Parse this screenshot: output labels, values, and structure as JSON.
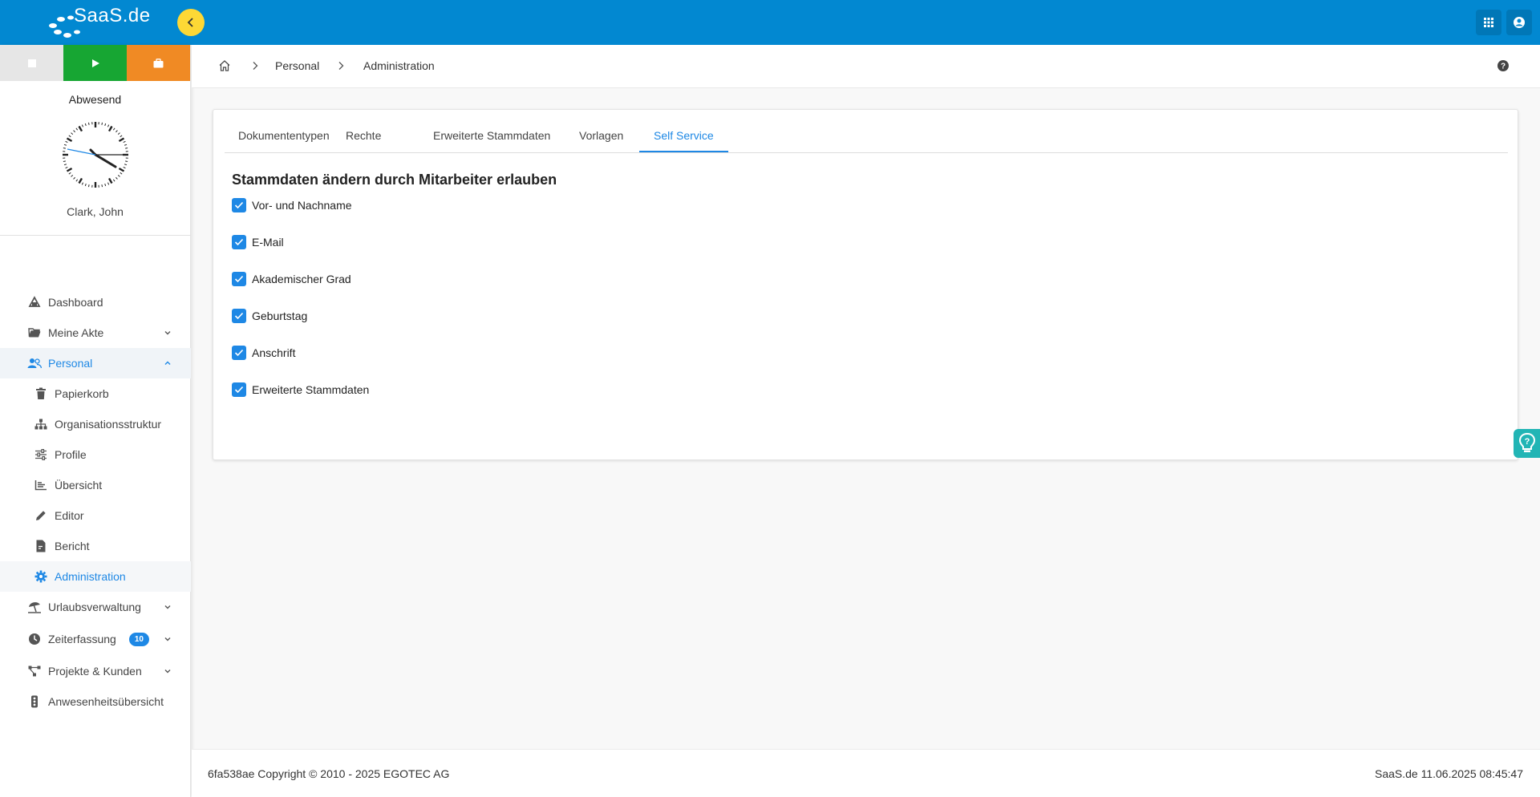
{
  "app": {
    "logo_text": "SaaS.de"
  },
  "colors": {
    "topbar": "#0288d1",
    "accent": "#1e88e5",
    "collapse": "#fdd835",
    "play": "#17a633",
    "break": "#f08a24"
  },
  "sidebar": {
    "status": "Abwesend",
    "user": "Clark, John",
    "nav": {
      "dashboard": "Dashboard",
      "meine_akte": "Meine Akte",
      "personal": "Personal",
      "papierkorb": "Papierkorb",
      "organisationsstruktur": "Organisationsstruktur",
      "profile": "Profile",
      "uebersicht": "Übersicht",
      "editor": "Editor",
      "bericht": "Bericht",
      "administration": "Administration",
      "urlaubsverwaltung": "Urlaubsverwaltung",
      "zeiterfassung": "Zeiterfassung",
      "zeiterfassung_badge": "10",
      "projekte": "Projekte & Kunden",
      "anwesenheit": "Anwesenheitsübersicht"
    }
  },
  "breadcrumb": {
    "level1": "Personal",
    "level2": "Administration"
  },
  "tabs": {
    "dokumententypen": "Dokumententypen",
    "rechte": "Rechte",
    "erweiterte": "Erweiterte Stammdaten",
    "vorlagen": "Vorlagen",
    "self_service": "Self Service"
  },
  "content": {
    "title": "Stammdaten ändern durch Mitarbeiter erlauben",
    "checkboxes": {
      "name": "Vor- und Nachname",
      "email": "E-Mail",
      "grad": "Akademischer Grad",
      "geburtstag": "Geburtstag",
      "anschrift": "Anschrift",
      "erweiterte": "Erweiterte Stammdaten"
    }
  },
  "footer": {
    "left": "6fa538ae Copyright © 2010 - 2025 EGOTEC AG",
    "right": "SaaS.de  11.06.2025 08:45:47"
  }
}
